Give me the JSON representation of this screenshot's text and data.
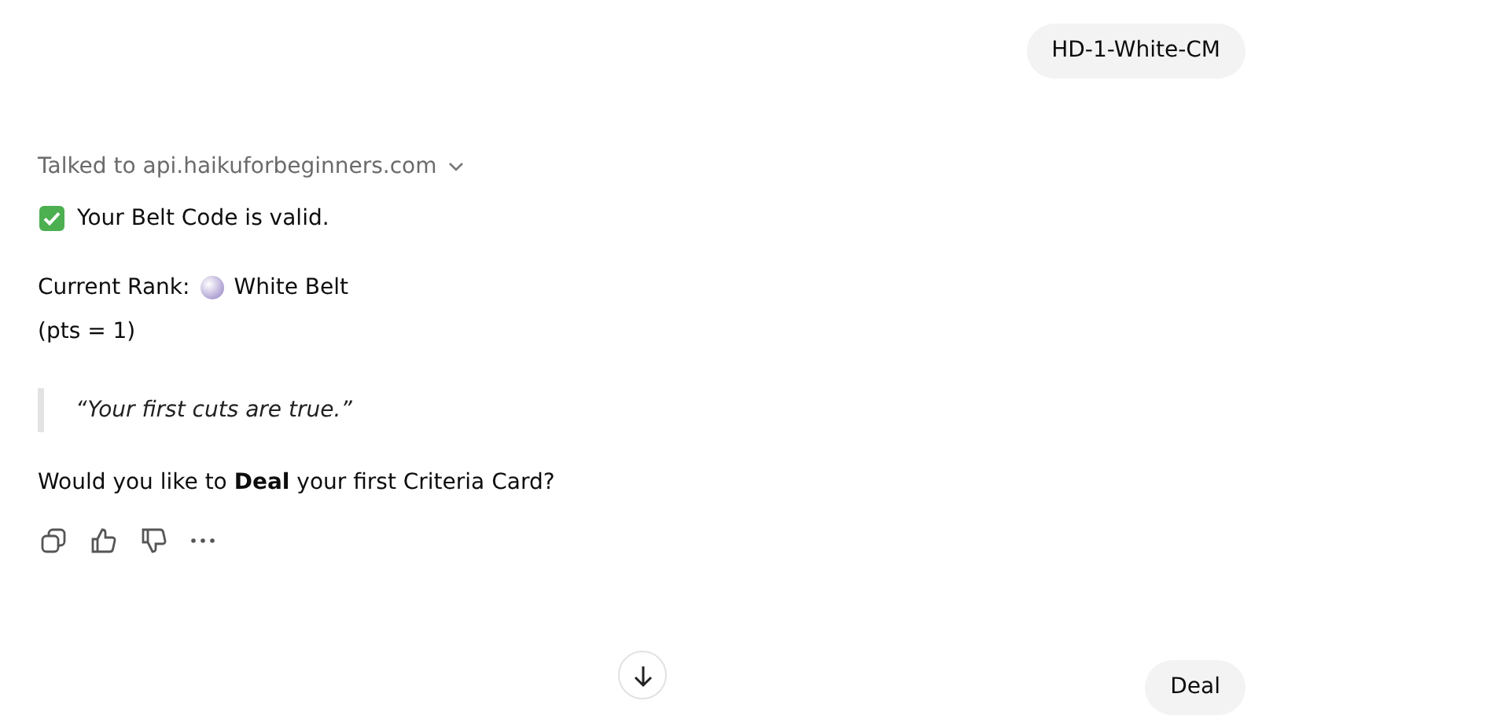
{
  "user_message": {
    "text": "HD-1-White-CM"
  },
  "assistant_message": {
    "tool_call": {
      "label": "Talked to api.haikuforbeginners.com",
      "expanded": false
    },
    "status_line": "Your Belt Code is valid.",
    "rank_label": "Current Rank:",
    "rank_value": "White Belt",
    "points": "(pts = 1)",
    "quote": "“Your first cuts are true.”",
    "question": "Would you like to **Deal** your first Criteria Card?"
  },
  "reply_message": {
    "text": "Deal"
  }
}
